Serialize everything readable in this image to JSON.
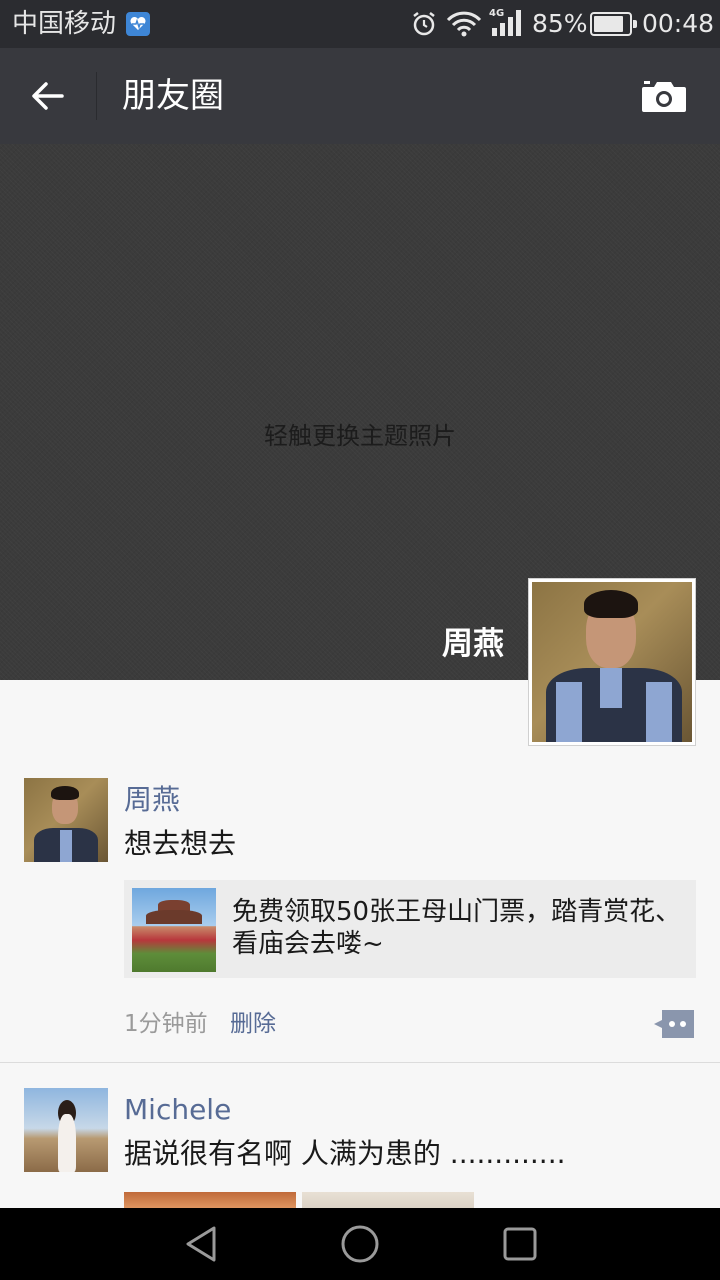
{
  "status_bar": {
    "carrier": "中国移动",
    "network": "4G",
    "battery_percent": "85%",
    "battery_level": 0.85,
    "time": "00:48",
    "icons": [
      "health-icon",
      "alarm-icon",
      "wifi-icon",
      "signal-icon",
      "battery-icon"
    ]
  },
  "app_bar": {
    "title": "朋友圈",
    "icons": [
      "back-arrow-icon",
      "camera-icon"
    ]
  },
  "cover": {
    "hint": "轻触更换主题照片",
    "profile_name": "周燕"
  },
  "posts": [
    {
      "author": "周燕",
      "text": "想去想去",
      "link_title": "免费领取50张王母山门票，踏青赏花、看庙会去喽~",
      "time": "1分钟前",
      "delete_label": "删除"
    },
    {
      "author": "Michele",
      "text": "据说很有名啊 人满为患的 ............."
    }
  ],
  "nav_bar": {
    "icons": [
      "nav-back-icon",
      "nav-home-icon",
      "nav-recent-icon"
    ]
  },
  "colors": {
    "status_bar_bg": "#2b2c30",
    "app_bar_bg": "#38393e",
    "cover_bg": "#3b3b3b",
    "link_blue": "#576b95",
    "feed_bg": "#f7f7f7",
    "nav_bar_bg": "#000000"
  }
}
